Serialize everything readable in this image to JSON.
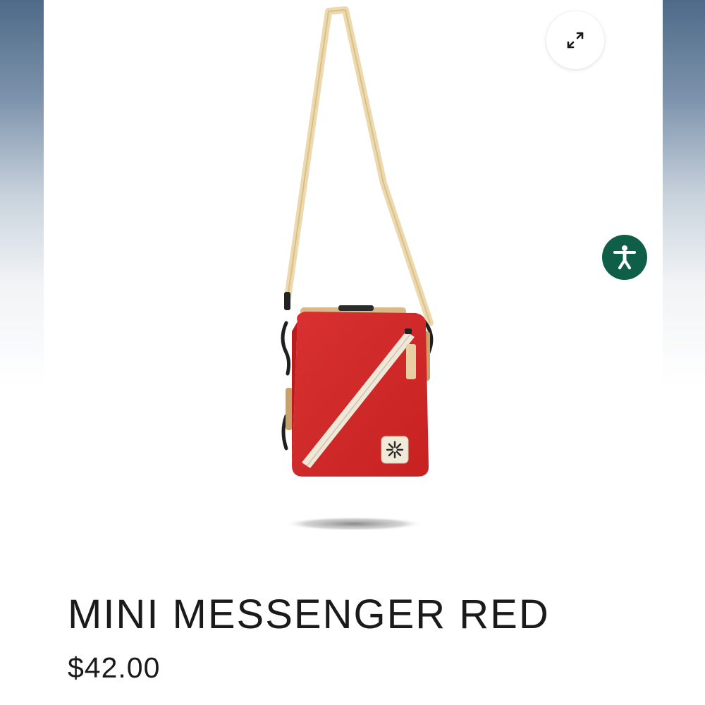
{
  "product": {
    "name": "MINI MESSENGER RED",
    "price": "$42.00",
    "image_subject": "red mini messenger bag with cream shoulder strap"
  },
  "controls": {
    "expand_icon": "expand-arrows-icon",
    "accessibility_icon": "accessibility-person-icon"
  },
  "colors": {
    "bag_red": "#d42a2a",
    "strap_cream": "#ecd9ae",
    "accessibility_green": "#0f5e48",
    "text": "#1a1a1a"
  }
}
